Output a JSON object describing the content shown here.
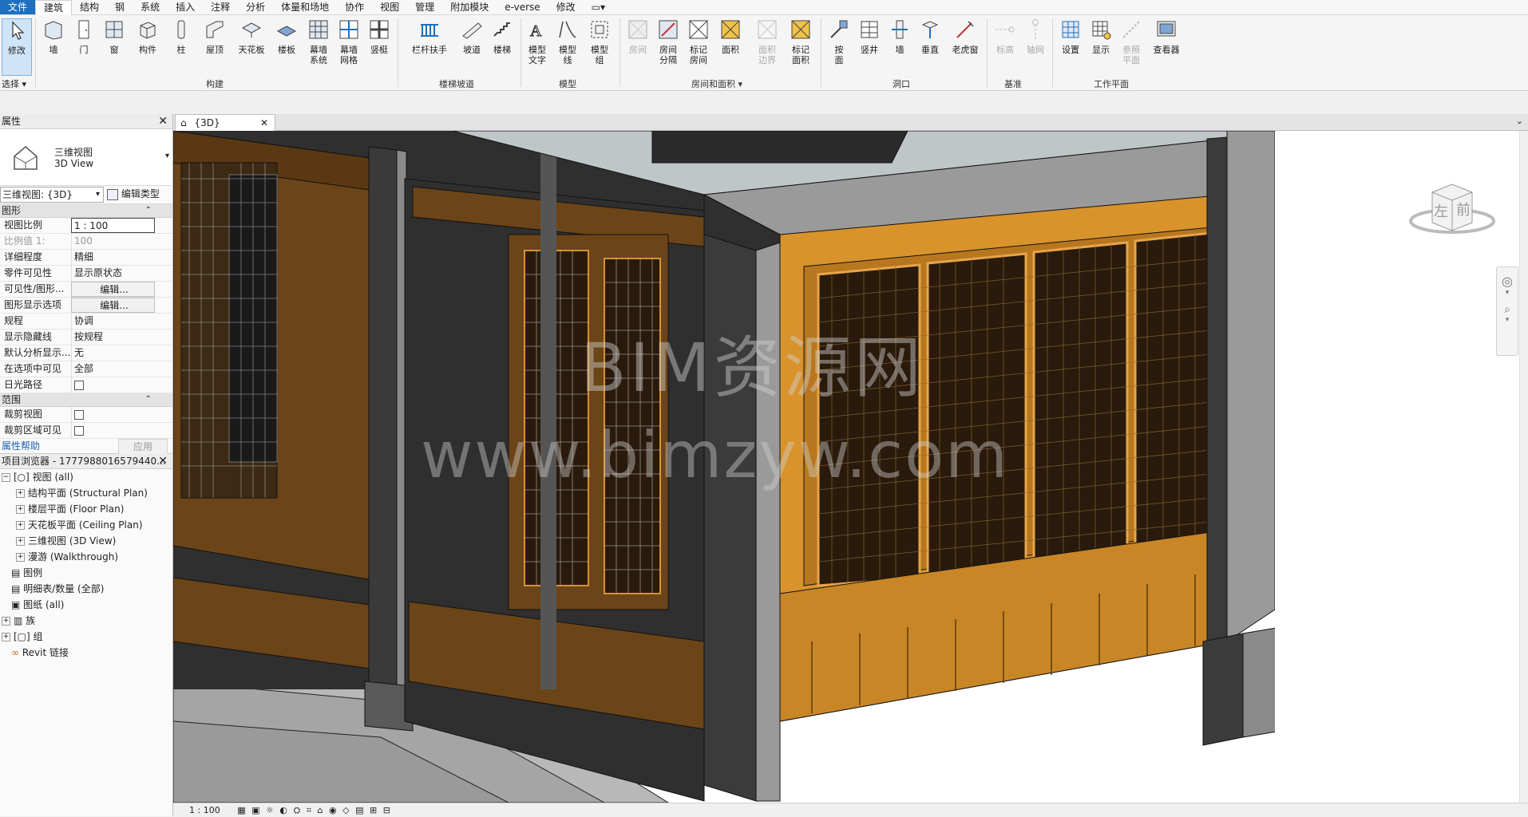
{
  "menu": [
    "文件",
    "建筑",
    "结构",
    "钢",
    "系统",
    "插入",
    "注释",
    "分析",
    "体量和场地",
    "协作",
    "视图",
    "管理",
    "附加模块",
    "e-verse",
    "修改"
  ],
  "ribbon": {
    "select_label": "选择",
    "modify_label": "修改",
    "tools": [
      {
        "label": "墙",
        "group": "build"
      },
      {
        "label": "门"
      },
      {
        "label": "窗"
      },
      {
        "label": "构件"
      },
      {
        "label": "柱"
      },
      {
        "label": "屋顶"
      },
      {
        "label": "天花板"
      },
      {
        "label": "楼板"
      },
      {
        "label": "幕墙\n系统"
      },
      {
        "label": "幕墙\n网格"
      },
      {
        "label": "竖梃"
      },
      {
        "label": "栏杆扶手"
      },
      {
        "label": "坡道"
      },
      {
        "label": "楼梯"
      },
      {
        "label": "模型\n文字"
      },
      {
        "label": "模型\n线"
      },
      {
        "label": "模型\n组"
      },
      {
        "label": "房间"
      },
      {
        "label": "房间\n分隔"
      },
      {
        "label": "标记\n房间"
      },
      {
        "label": "面积"
      },
      {
        "label": "面积\n边界"
      },
      {
        "label": "标记\n面积"
      },
      {
        "label": "按\n面"
      },
      {
        "label": "竖井"
      },
      {
        "label": "墙"
      },
      {
        "label": "垂直"
      },
      {
        "label": "老虎窗"
      },
      {
        "label": "标高"
      },
      {
        "label": "轴网"
      },
      {
        "label": "设置"
      },
      {
        "label": "显示"
      },
      {
        "label": "参照\n平面"
      },
      {
        "label": "查看器"
      }
    ],
    "groups": [
      "构建",
      "楼梯坡道",
      "模型",
      "房间和面积",
      "洞口",
      "基准",
      "工作平面"
    ]
  },
  "properties": {
    "title": "属性",
    "type_cn": "三维视图",
    "type_en": "3D View",
    "view_selector": "三维视图: {3D}",
    "edit_type": "编辑类型",
    "section_graphics": "图形",
    "rows": [
      {
        "k": "视图比例",
        "v": "1 : 100"
      },
      {
        "k": "比例值 1:",
        "v": "100"
      },
      {
        "k": "详细程度",
        "v": "精细"
      },
      {
        "k": "零件可见性",
        "v": "显示原状态"
      },
      {
        "k": "可见性/图形...",
        "v": "编辑..."
      },
      {
        "k": "图形显示选项",
        "v": "编辑..."
      },
      {
        "k": "规程",
        "v": "协调"
      },
      {
        "k": "显示隐藏线",
        "v": "按规程"
      },
      {
        "k": "默认分析显示...",
        "v": "无"
      },
      {
        "k": "在选项中可见",
        "v": "全部"
      },
      {
        "k": "日光路径",
        "v": ""
      }
    ],
    "section_extent": "范围",
    "rows2": [
      {
        "k": "裁剪视图",
        "v": ""
      },
      {
        "k": "裁剪区域可见",
        "v": ""
      }
    ],
    "help_link": "属性帮助",
    "apply": "应用"
  },
  "browser": {
    "title": "项目浏览器 - 1777988016579440...",
    "items": [
      "视图 (all)",
      "结构平面 (Structural Plan)",
      "楼层平面 (Floor Plan)",
      "天花板平面 (Ceiling Plan)",
      "三维视图 (3D View)",
      "漫游 (Walkthrough)",
      "图例",
      "明细表/数量 (全部)",
      "图纸 (all)",
      "族",
      "组",
      "Revit 链接"
    ]
  },
  "view": {
    "tab_label": "{3D}",
    "scale": "1 : 100",
    "watermark_cn": "BIM资源网",
    "watermark_url": "www.bimzyw.com",
    "viewcube_left": "左",
    "viewcube_front": "前"
  },
  "colors": {
    "accent": "#1f6fbf",
    "wood_light": "#d8932c",
    "wood_dark": "#6b4418",
    "column": "#3b3b3b",
    "concrete": "#9a9a9a"
  }
}
